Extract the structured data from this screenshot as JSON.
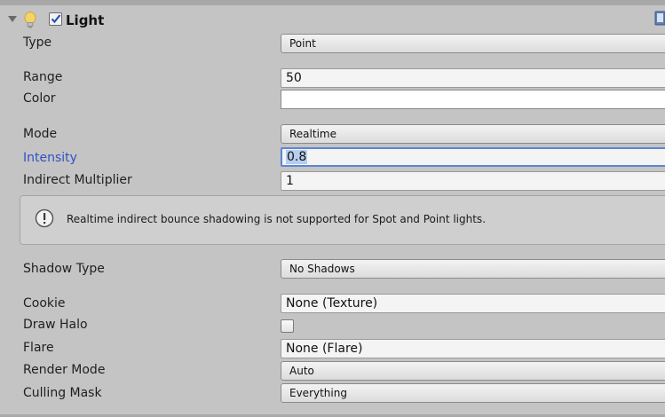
{
  "component": {
    "title": "Light",
    "enabled": true,
    "icons": [
      "foldout-arrow-icon",
      "light-bulb-icon",
      "enabled-checkbox",
      "help-book-icon"
    ]
  },
  "fields": {
    "type": {
      "label": "Type",
      "value": "Point"
    },
    "range": {
      "label": "Range",
      "value": "50"
    },
    "color": {
      "label": "Color",
      "value": "#ffffff"
    },
    "mode": {
      "label": "Mode",
      "value": "Realtime"
    },
    "intensity": {
      "label": "Intensity",
      "value": "0.8"
    },
    "indirect_multiplier": {
      "label": "Indirect Multiplier",
      "value": "1"
    },
    "shadow_type": {
      "label": "Shadow Type",
      "value": "No Shadows"
    },
    "cookie": {
      "label": "Cookie",
      "value": "None (Texture)"
    },
    "draw_halo": {
      "label": "Draw Halo",
      "checked": false
    },
    "flare": {
      "label": "Flare",
      "value": "None (Flare)"
    },
    "render_mode": {
      "label": "Render Mode",
      "value": "Auto"
    },
    "culling_mask": {
      "label": "Culling Mask",
      "value": "Everything"
    }
  },
  "help": {
    "message": "Realtime indirect bounce shadowing is not supported for Spot and Point lights.",
    "icon": "info-icon"
  },
  "colors": {
    "panel_bg": "#c4c4c4",
    "focus_label": "#2f52c9",
    "focus_border": "#5b86d6",
    "selection": "#b7cdf0"
  }
}
